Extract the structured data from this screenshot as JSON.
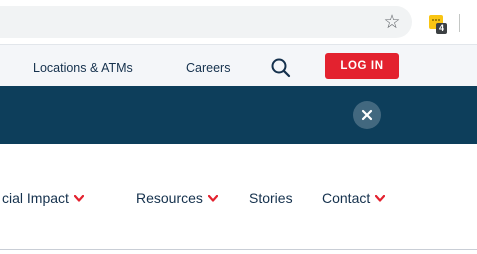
{
  "browser": {
    "bookmark_icon": "star-outline-icon",
    "extension_icon": "extension-note-icon",
    "extension_badge": "4"
  },
  "utility_nav": {
    "items": [
      {
        "label": "Locations & ATMs"
      },
      {
        "label": "Careers"
      }
    ],
    "search_icon": "search-icon",
    "login_label": "LOG IN"
  },
  "alert": {
    "close_icon": "close-icon"
  },
  "main_nav": {
    "items": [
      {
        "label": "cial Impact",
        "has_dropdown": true
      },
      {
        "label": "Resources",
        "has_dropdown": true
      },
      {
        "label": "Stories",
        "has_dropdown": false
      },
      {
        "label": "Contact",
        "has_dropdown": true
      }
    ]
  },
  "colors": {
    "primary_navy": "#0d3e5b",
    "text_navy": "#15314d",
    "accent_red": "#e3222f",
    "utility_background": "#f4f6f9"
  }
}
